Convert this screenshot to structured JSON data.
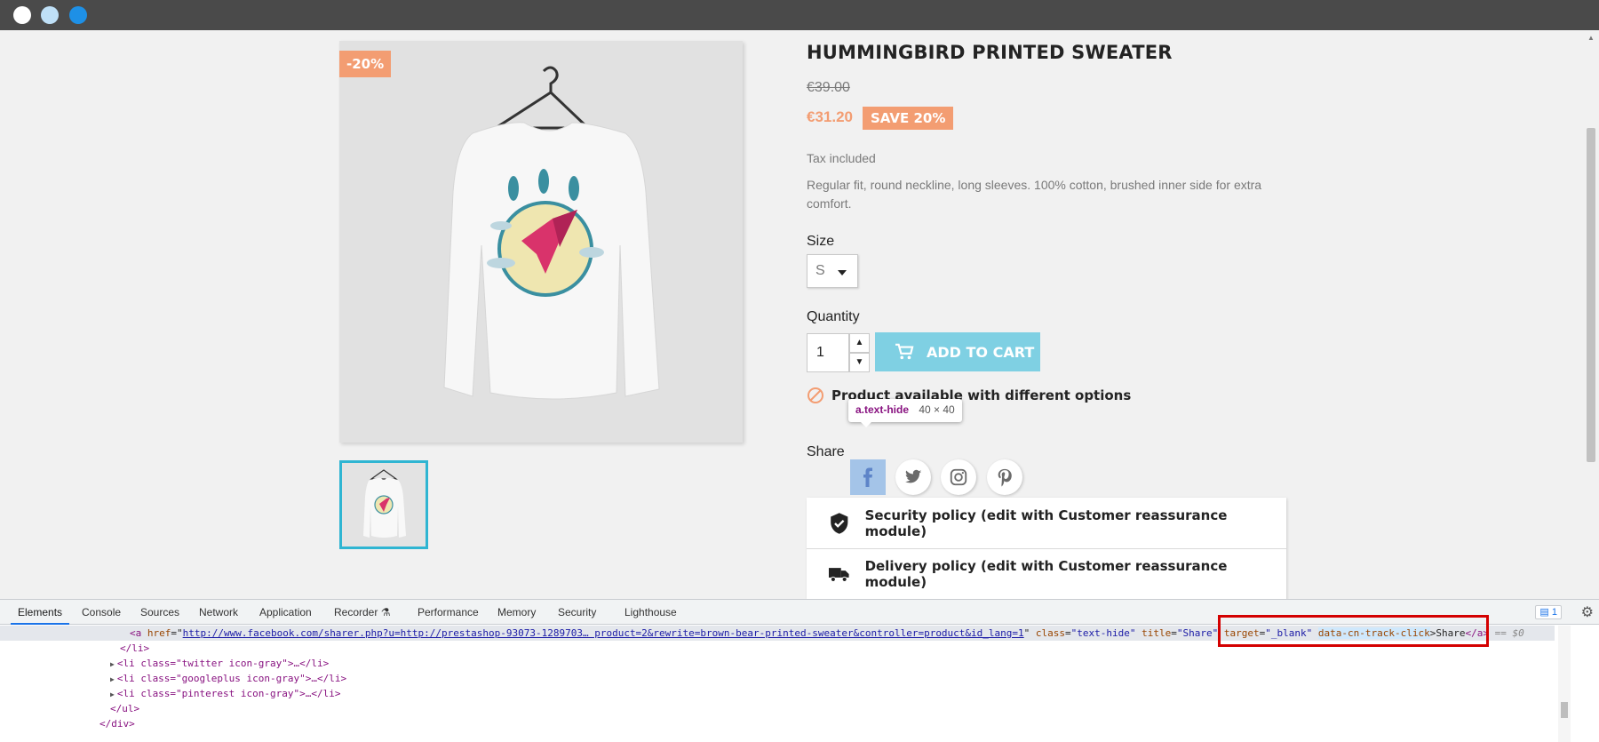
{
  "window": {
    "controls": [
      "close",
      "minimize",
      "maximize"
    ]
  },
  "product": {
    "discount_flag": "-20%",
    "title": "HUMMINGBIRD PRINTED SWEATER",
    "old_price": "€39.00",
    "new_price": "€31.20",
    "save_badge": "SAVE 20%",
    "tax": "Tax included",
    "description": "Regular fit, round neckline, long sleeves. 100% cotton, brushed inner side for extra comfort.",
    "size_label": "Size",
    "size_value": "S",
    "quantity_label": "Quantity",
    "quantity_value": "1",
    "add_to_cart": "ADD TO CART",
    "availability": "Product available with different options",
    "share_label": "Share",
    "share_icons": [
      "facebook-icon",
      "twitter-icon",
      "instagram-icon",
      "pinterest-icon"
    ],
    "reassurance": [
      {
        "icon": "shield-check-icon",
        "text": "Security policy (edit with Customer reassurance module)"
      },
      {
        "icon": "truck-icon",
        "text": "Delivery policy (edit with Customer reassurance module)"
      }
    ],
    "colors": {
      "accent": "#f39d72",
      "cart": "#7fd0e3",
      "thumb_border": "#2fb5d2"
    }
  },
  "tooltip": {
    "selector": "a.text-hide",
    "size": "40 × 40"
  },
  "devtools": {
    "tabs": [
      "Elements",
      "Console",
      "Sources",
      "Network",
      "Application",
      "Recorder",
      "Performance",
      "Memory",
      "Security",
      "Lighthouse"
    ],
    "active_tab": "Elements",
    "issues_count": "1",
    "selected_line": {
      "tag_open": "<a",
      "href_attr": "href",
      "href_val": "http://www.facebook.com/sharer.php?u=http://prestashop-93073-1289703… product=2&rewrite=brown-bear-printed-sweater&controller=product&id_lang=1",
      "class_attr": "class",
      "class_val": "\"text-hide\"",
      "title_attr": "title",
      "title_val": "\"Share\"",
      "target_attr": "target",
      "target_val": "\"_blank\"",
      "track_attr": "data-cn-track-click",
      "text": "Share",
      "tag_close": "</a>",
      "ref": "== $0"
    },
    "lines": [
      {
        "text": "</li>"
      },
      {
        "text": "<li class=\"twitter icon-gray\">…</li>"
      },
      {
        "text": "<li class=\"googleplus icon-gray\">…</li>"
      },
      {
        "text": "<li class=\"pinterest icon-gray\">…</li>"
      },
      {
        "text": "</ul>"
      },
      {
        "text": "</div>"
      }
    ]
  }
}
